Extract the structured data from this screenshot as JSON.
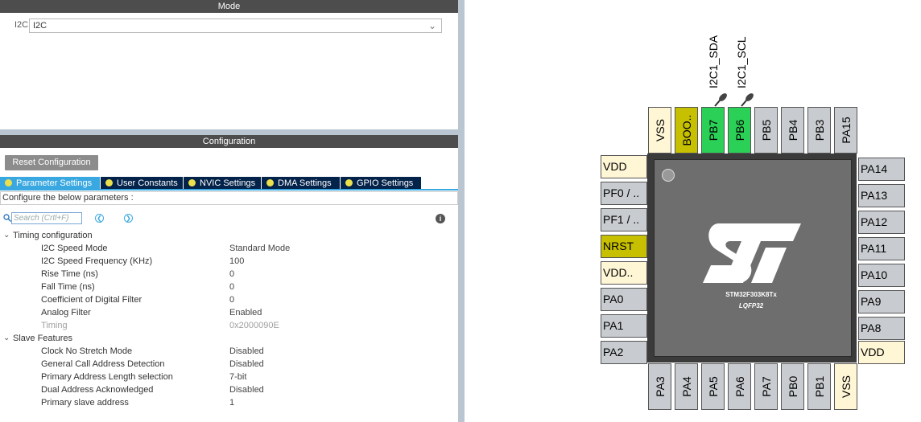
{
  "mode": {
    "header": "Mode",
    "field_label": "I2C",
    "field_value": "I2C"
  },
  "configuration": {
    "header": "Configuration",
    "reset_label": "Reset Configuration",
    "tabs": [
      {
        "label": "Parameter Settings"
      },
      {
        "label": "User Constants"
      },
      {
        "label": "NVIC Settings"
      },
      {
        "label": "DMA Settings"
      },
      {
        "label": "GPIO Settings"
      }
    ],
    "description": "Configure the below parameters :",
    "search_placeholder": "Search (Crtl+F)",
    "groups": [
      {
        "name": "Timing configuration",
        "params": [
          {
            "name": "I2C Speed Mode",
            "value": "Standard Mode"
          },
          {
            "name": "I2C Speed Frequency (KHz)",
            "value": "100"
          },
          {
            "name": "Rise Time (ns)",
            "value": "0"
          },
          {
            "name": "Fall Time (ns)",
            "value": "0"
          },
          {
            "name": "Coefficient of Digital Filter",
            "value": "0"
          },
          {
            "name": "Analog Filter",
            "value": "Enabled"
          },
          {
            "name": "Timing",
            "value": "0x2000090E"
          }
        ]
      },
      {
        "name": "Slave Features",
        "params": [
          {
            "name": "Clock No Stretch Mode",
            "value": "Disabled"
          },
          {
            "name": "General Call Address Detection",
            "value": "Disabled"
          },
          {
            "name": "Primary Address Length selection",
            "value": "7-bit"
          },
          {
            "name": "Dual Address Acknowledged",
            "value": "Disabled"
          },
          {
            "name": "Primary slave address",
            "value": "1"
          }
        ]
      }
    ]
  },
  "chip": {
    "part": "STM32F303K8Tx",
    "package": "LQFP32",
    "top_pins": [
      "VSS",
      "BOO..",
      "PB7",
      "PB6",
      "PB5",
      "PB4",
      "PB3",
      "PA15"
    ],
    "bottom_pins": [
      "PA3",
      "PA4",
      "PA5",
      "PA6",
      "PA7",
      "PB0",
      "PB1",
      "VSS"
    ],
    "left_pins": [
      "VDD",
      "PF0 / ..",
      "PF1 / ..",
      "NRST",
      "VDD..",
      "PA0",
      "PA1",
      "PA2"
    ],
    "right_pins": [
      "PA14",
      "PA13",
      "PA12",
      "PA11",
      "PA10",
      "PA9",
      "PA8",
      "VDD"
    ],
    "signals": {
      "pb7": "I2C1_SDA",
      "pb6": "I2C1_SCL"
    },
    "colors": {
      "used": "#2bd157",
      "power": "#fff6d6",
      "reset_boot": "#c7c000",
      "default": "#c8ccd0"
    }
  }
}
